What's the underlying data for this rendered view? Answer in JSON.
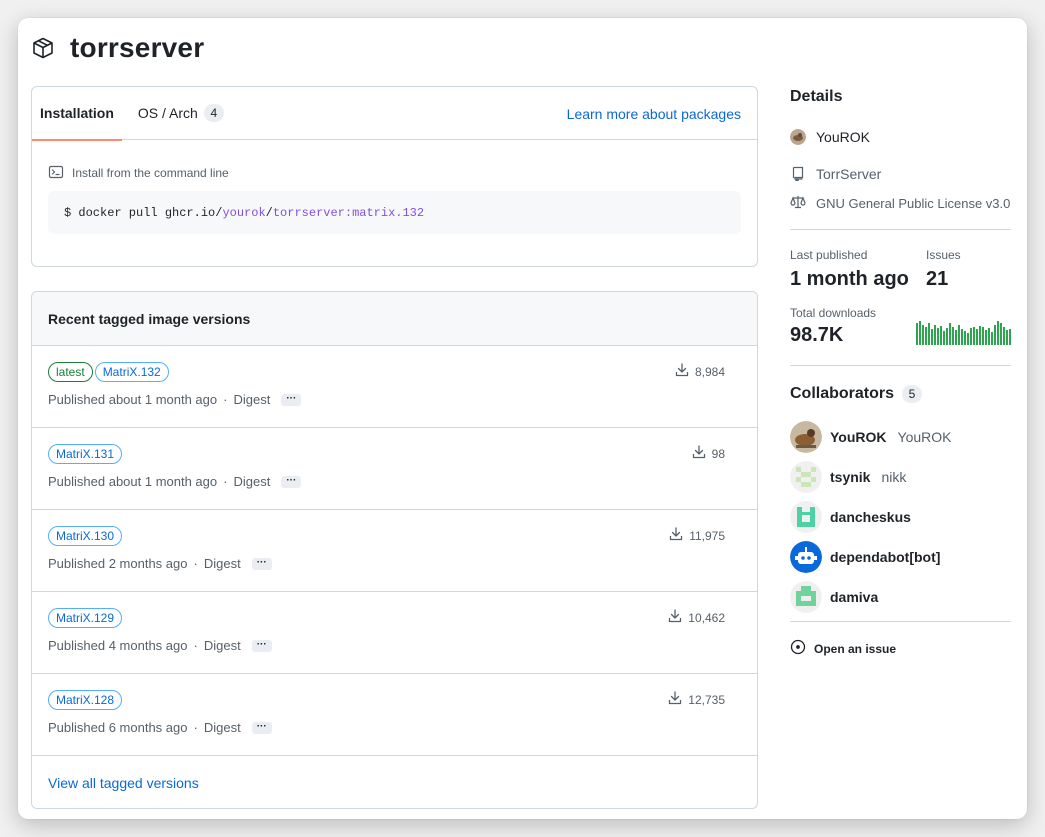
{
  "package": {
    "name": "torrserver"
  },
  "install": {
    "tabs": [
      {
        "label": "Installation"
      },
      {
        "label": "OS / Arch",
        "count": "4"
      }
    ],
    "learn_more": "Learn more about packages",
    "cli_label": "Install from the command line",
    "command": {
      "prefix": "$ docker pull ghcr.io/",
      "owner": "yourok",
      "sep": "/",
      "image": "torrserver:matrix.132"
    }
  },
  "versions": {
    "heading": "Recent tagged image versions",
    "rows": [
      {
        "tags": [
          "latest",
          "MatriX.132"
        ],
        "published": "Published about 1 month ago",
        "digest": "Digest",
        "downloads": "8,984"
      },
      {
        "tags": [
          "MatriX.131"
        ],
        "published": "Published about 1 month ago",
        "digest": "Digest",
        "downloads": "98"
      },
      {
        "tags": [
          "MatriX.130"
        ],
        "published": "Published 2 months ago",
        "digest": "Digest",
        "downloads": "11,975"
      },
      {
        "tags": [
          "MatriX.129"
        ],
        "published": "Published 4 months ago",
        "digest": "Digest",
        "downloads": "10,462"
      },
      {
        "tags": [
          "MatriX.128"
        ],
        "published": "Published 6 months ago",
        "digest": "Digest",
        "downloads": "12,735"
      }
    ],
    "view_all": "View all tagged versions",
    "more_label": "···",
    "separator": "·"
  },
  "details": {
    "heading": "Details",
    "owner": "YouROK",
    "repo": "TorrServer",
    "license": "GNU General Public License v3.0",
    "last_published_label": "Last published",
    "last_published": "1 month ago",
    "issues_label": "Issues",
    "issues": "21",
    "downloads_label": "Total downloads",
    "downloads": "98.7K",
    "downloads_sparkline": [
      22,
      24,
      20,
      18,
      22,
      16,
      20,
      17,
      19,
      14,
      17,
      22,
      18,
      15,
      20,
      16,
      14,
      12,
      17,
      18,
      16,
      19,
      18,
      15,
      17,
      13,
      20,
      24,
      22,
      18,
      15,
      16
    ],
    "accent_color": "#2da44e"
  },
  "collaborators": {
    "heading": "Collaborators",
    "count": "5",
    "people": [
      {
        "login": "YouROK",
        "name": "YouROK"
      },
      {
        "login": "tsynik",
        "name": "nikk"
      },
      {
        "login": "dancheskus",
        "name": ""
      },
      {
        "login": "dependabot[bot]",
        "name": ""
      },
      {
        "login": "damiva",
        "name": ""
      }
    ]
  },
  "open_issue": "Open an issue"
}
